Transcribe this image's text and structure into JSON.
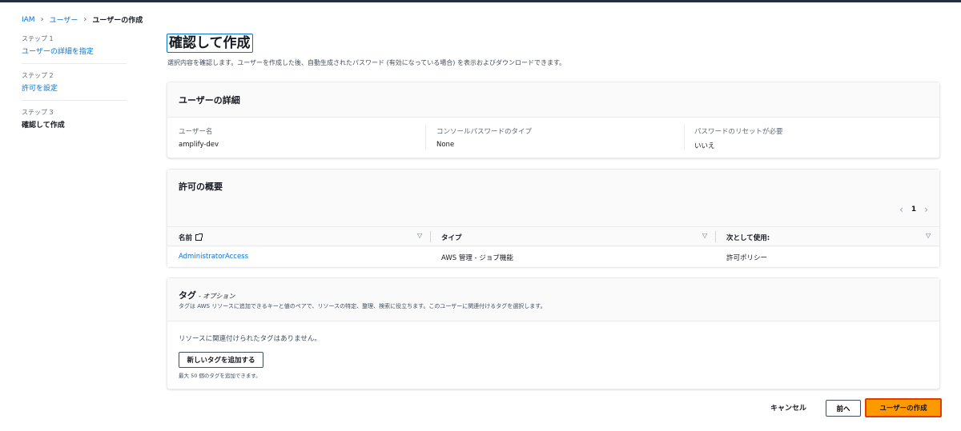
{
  "breadcrumb": {
    "items": [
      "IAM",
      "ユーザー",
      "ユーザーの作成"
    ]
  },
  "steps": [
    {
      "num": "ステップ 1",
      "label": "ユーザーの詳細を指定"
    },
    {
      "num": "ステップ 2",
      "label": "許可を設定"
    },
    {
      "num": "ステップ 3",
      "label": "確認して作成"
    }
  ],
  "page": {
    "title": "確認して作成",
    "description": "選択内容を確認します。ユーザーを作成した後、自動生成されたパスワード (有効になっている場合) を表示およびダウンロードできます。"
  },
  "user_details": {
    "title": "ユーザーの詳細",
    "fields": [
      {
        "label": "ユーザー名",
        "value": "amplify-dev"
      },
      {
        "label": "コンソールパスワードのタイプ",
        "value": "None"
      },
      {
        "label": "パスワードのリセットが必要",
        "value": "いいえ"
      }
    ]
  },
  "permissions": {
    "title": "許可の概要",
    "page": "1",
    "prev_icon": "chevron-left-icon",
    "next_icon": "chevron-right-icon",
    "columns": [
      "名前",
      "タイプ",
      "次として使用:"
    ],
    "rows": [
      {
        "name": "AdministratorAccess",
        "type": "AWS 管理 - ジョブ機能",
        "usage": "許可ポリシー"
      }
    ]
  },
  "tags": {
    "title": "タグ",
    "optional": "- オプション",
    "description": "タグは AWS リソースに追加できるキーと値のペアで、リソースの特定、整理、検索に役立ちます。このユーザーに関連付けるタグを選択します。",
    "empty": "リソースに関連付けられたタグはありません。",
    "add_button": "新しいタグを追加する",
    "limit": "最大 50 個のタグを追加できます。"
  },
  "footer": {
    "cancel": "キャンセル",
    "prev": "前へ",
    "create": "ユーザーの作成"
  },
  "colors": {
    "link": "#0972d3",
    "primary_button": "#ff9900",
    "primary_border": "#e23c00",
    "topbar": "#232f3e"
  }
}
